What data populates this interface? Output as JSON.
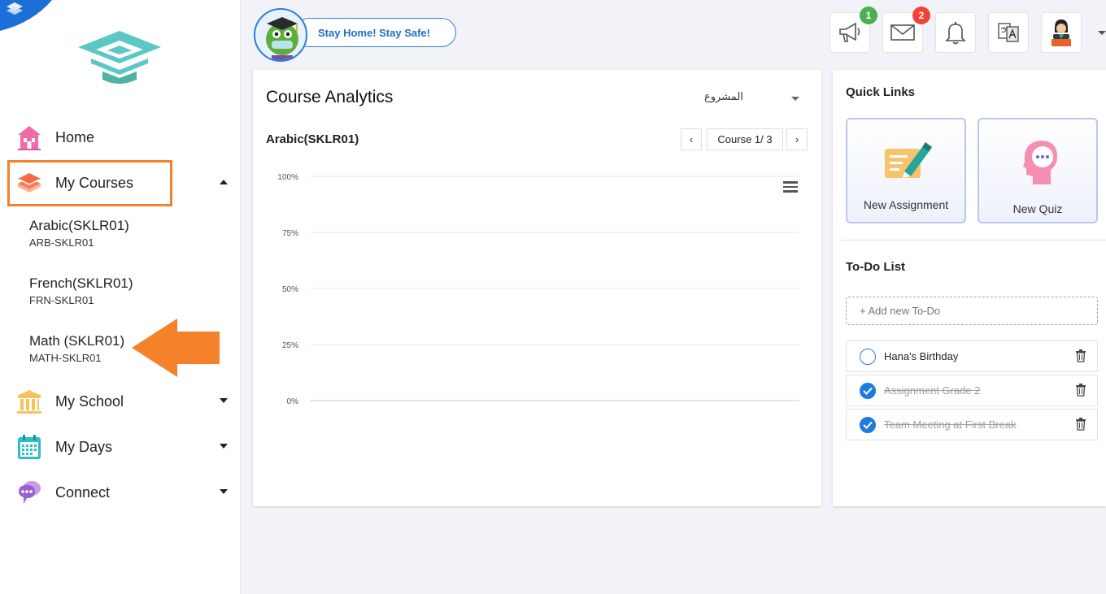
{
  "sidebar": {
    "items": [
      {
        "label": "Home"
      },
      {
        "label": "My Courses"
      },
      {
        "label": "My School"
      },
      {
        "label": "My Days"
      },
      {
        "label": "Connect"
      }
    ],
    "courses": [
      {
        "name": "Arabic(SKLR01)",
        "code": "ARB-SKLR01"
      },
      {
        "name": "French(SKLR01)",
        "code": "FRN-SKLR01"
      },
      {
        "name": "Math (SKLR01)",
        "code": "MATH-SKLR01"
      }
    ]
  },
  "topbar": {
    "banner_text": "Stay Home! Stay Safe!",
    "announcements_badge": "1",
    "messages_badge": "2"
  },
  "analytics": {
    "title": "Course Analytics",
    "select_value": "المشروع",
    "course_name": "Arabic(SKLR01)",
    "pager_label": "Course 1/ 3",
    "prev_symbol": "‹",
    "next_symbol": "›"
  },
  "chart_data": {
    "type": "bar",
    "categories": [],
    "values": [],
    "y_ticks": [
      "100%",
      "75%",
      "50%",
      "25%",
      "0%"
    ],
    "ylim": [
      0,
      100
    ],
    "grid": true
  },
  "quick_links": {
    "title": "Quick Links",
    "items": [
      {
        "label": "New Assignment"
      },
      {
        "label": "New Quiz"
      }
    ]
  },
  "todo": {
    "title": "To-Do List",
    "placeholder": "+ Add new To-Do",
    "items": [
      {
        "text": "Hana's Birthday",
        "done": false
      },
      {
        "text": "Assignment Grade 2",
        "done": true
      },
      {
        "text": "Team Meeting at First Break",
        "done": true
      }
    ]
  },
  "colors": {
    "accent_orange": "#f5822a",
    "link_blue": "#1f6ec4",
    "badge_green": "#4caf50",
    "badge_red": "#f44336"
  }
}
